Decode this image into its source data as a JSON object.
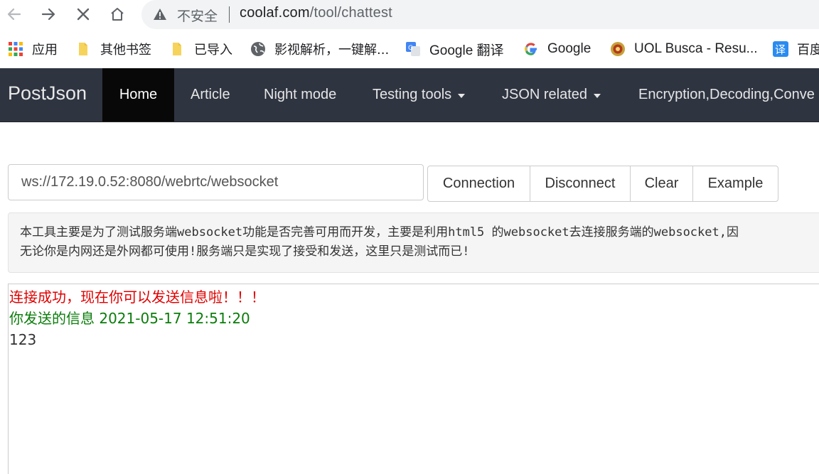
{
  "browser": {
    "insecure_label": "不安全",
    "url_host": "coolaf.com",
    "url_path": "/tool/chattest",
    "bookmarks": [
      {
        "label": "应用",
        "icon": "apps-grid-icon"
      },
      {
        "label": "其他书签",
        "icon": "folder-icon"
      },
      {
        "label": "已导入",
        "icon": "folder-icon"
      },
      {
        "label": "影视解析，一键解...",
        "icon": "globe-icon"
      },
      {
        "label": "Google 翻译",
        "icon": "google-translate-icon"
      },
      {
        "label": "Google",
        "icon": "google-g-icon"
      },
      {
        "label": "UOL Busca - Resu...",
        "icon": "uol-icon"
      },
      {
        "label": "百度",
        "icon": "translate-badge-icon"
      }
    ]
  },
  "navbar": {
    "brand": "PostJson",
    "items": [
      {
        "label": "Home",
        "active": true
      },
      {
        "label": "Article"
      },
      {
        "label": "Night mode"
      },
      {
        "label": "Testing tools",
        "dropdown": true
      },
      {
        "label": "JSON related",
        "dropdown": true
      },
      {
        "label": "Encryption,Decoding,Conve"
      }
    ]
  },
  "controls": {
    "ws_url": "ws://172.19.0.52:8080/webrtc/websocket",
    "buttons": [
      "Connection",
      "Disconnect",
      "Clear",
      "Example"
    ]
  },
  "note": {
    "line1": "本工具主要是为了测试服务端websocket功能是否完善可用而开发，主要是利用html5 的websocket去连接服务端的websocket,因",
    "line2": "无论你是内网还是外网都可使用!服务端只是实现了接受和发送，这里只是测试而已!"
  },
  "log": {
    "success": "连接成功，现在你可以发送信息啦！！！",
    "sent_header": "你发送的信息 2021-05-17 12:51:20",
    "sent_body": "123"
  },
  "colors": {
    "navbar_bg": "#2f3441",
    "nav_active_bg": "#080808",
    "success_text": "#e00000",
    "sent_text": "#0a7d0a"
  }
}
